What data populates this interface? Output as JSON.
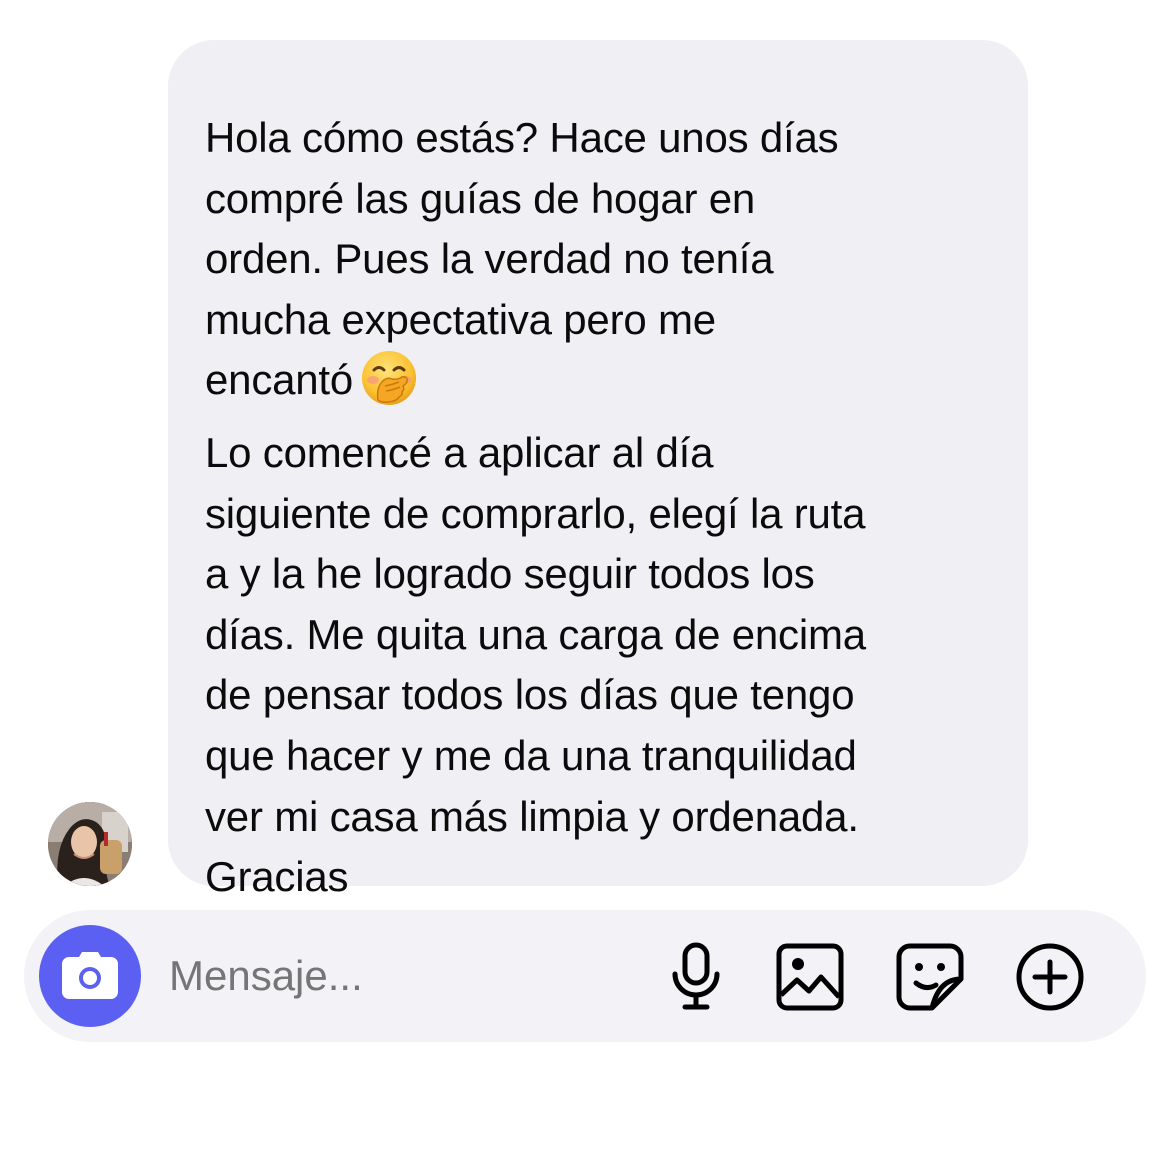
{
  "message": {
    "lines": [
      "Hola cómo estás? Hace unos días",
      "compré las guías de hogar en",
      "orden. Pues la verdad no tenía",
      "mucha expectativa pero me",
      "encantó",
      "Lo comencé a aplicar al día",
      "siguiente de comprarlo, elegí la ruta",
      "a y la he logrado seguir todos los",
      "días. Me quita una carga de encima",
      "de pensar todos los días que tengo",
      "que hacer y me da una tranquilidad",
      "ver mi casa más limpia y ordenada.",
      "Gracias"
    ],
    "emoji": "face-with-hand-over-mouth-emoji"
  },
  "composer": {
    "placeholder": "Mensaje...",
    "camera_icon": "camera-icon",
    "tools": [
      "microphone-icon",
      "image-icon",
      "sticker-icon",
      "plus-circle-icon"
    ]
  },
  "colors": {
    "bubble": "#efeff4",
    "composer": "#f2f2f7",
    "camera_button": "#5b5ff2",
    "text": "#0b0b0b",
    "placeholder": "#6e6e78"
  }
}
